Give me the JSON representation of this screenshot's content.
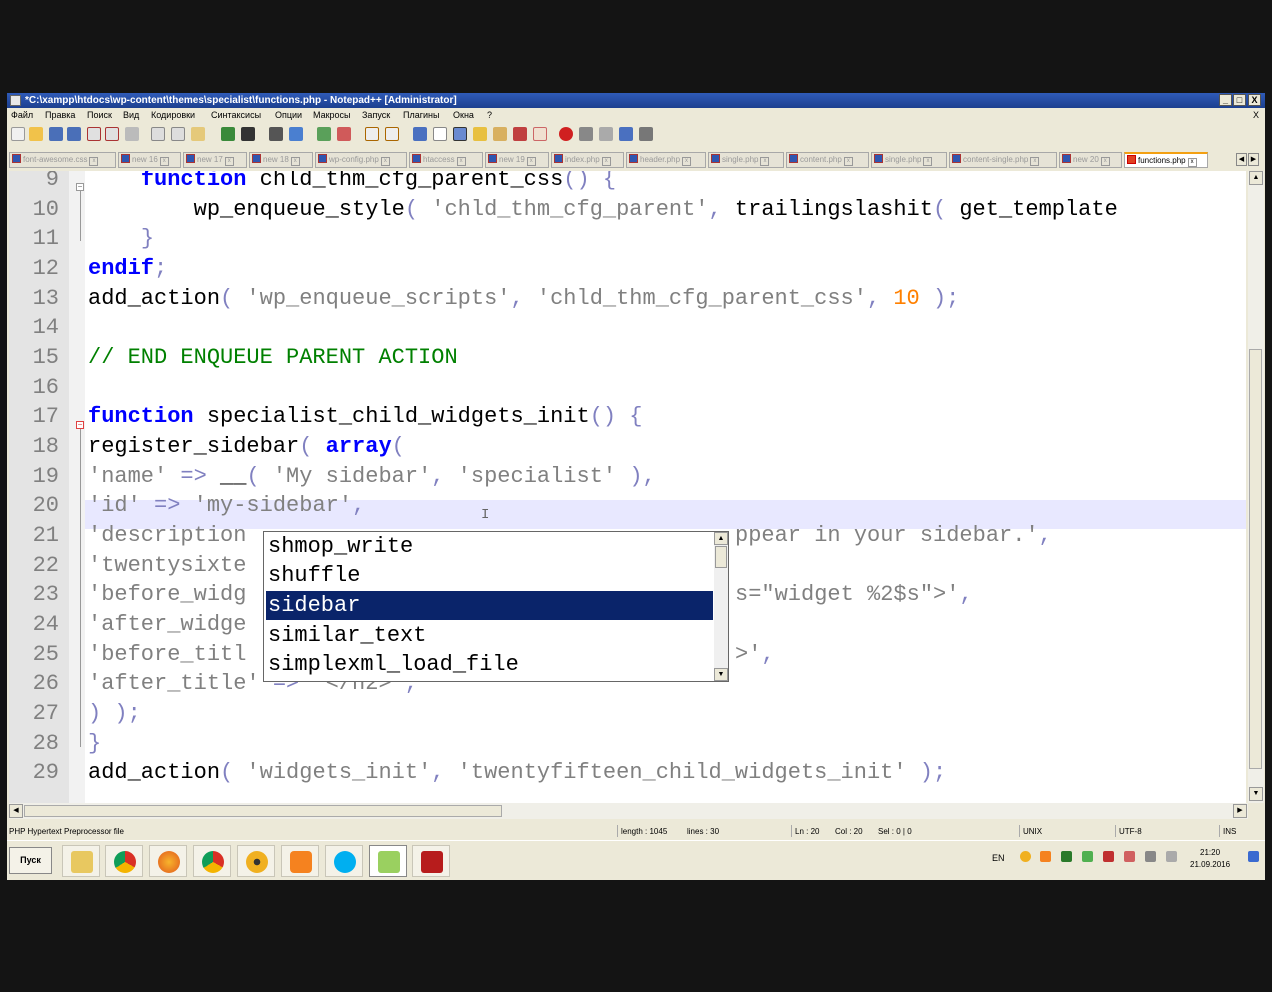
{
  "window": {
    "title": "*C:\\xampp\\htdocs\\wp-content\\themes\\specialist\\functions.php - Notepad++ [Administrator]",
    "min": "_",
    "max": "□",
    "close": "X"
  },
  "menu": [
    "Файл",
    "Правка",
    "Поиск",
    "Вид",
    "Кодировки",
    "Синтаксисы",
    "Опции",
    "Макросы",
    "Запуск",
    "Плагины",
    "Окна",
    "?"
  ],
  "menu_close": "X",
  "tabs": [
    {
      "label": "font-awesome.css"
    },
    {
      "label": "new 16"
    },
    {
      "label": "new 17"
    },
    {
      "label": "new 18"
    },
    {
      "label": "wp-config.php"
    },
    {
      "label": "htaccess"
    },
    {
      "label": "new 19"
    },
    {
      "label": "index.php"
    },
    {
      "label": "header.php"
    },
    {
      "label": "single.php"
    },
    {
      "label": "content.php"
    },
    {
      "label": "single.php"
    },
    {
      "label": "content-single.php"
    },
    {
      "label": "new 20"
    },
    {
      "label": "functions.php"
    }
  ],
  "lines": [
    {
      "n": "9",
      "t": "function"
    },
    {
      "n": "10"
    },
    {
      "n": "11"
    },
    {
      "n": "12"
    },
    {
      "n": "13"
    },
    {
      "n": "14"
    },
    {
      "n": "15"
    },
    {
      "n": "16"
    },
    {
      "n": "17"
    },
    {
      "n": "18"
    },
    {
      "n": "19"
    },
    {
      "n": "20"
    },
    {
      "n": "21"
    },
    {
      "n": "22"
    },
    {
      "n": "23"
    },
    {
      "n": "24"
    },
    {
      "n": "25"
    },
    {
      "n": "26"
    },
    {
      "n": "27"
    },
    {
      "n": "28"
    },
    {
      "n": "29"
    }
  ],
  "code": {
    "l9": {
      "kw": "function",
      "rest": " chld_thm_cfg_parent_css",
      "p": "()",
      "b": " {"
    },
    "l10": {
      "fn": "wp_enqueue_style",
      "p": "(",
      "s": " 'chld_thm_cfg_parent'",
      "c": ",",
      "fn2": " trailingslashit",
      "p2": "(",
      "fn3": " get_template"
    },
    "l11": {
      "b": "}"
    },
    "l12": {
      "kw": "endif",
      "c": ";"
    },
    "l13": {
      "fn": "add_action",
      "p": "(",
      "s1": " 'wp_enqueue_scripts'",
      "c1": ",",
      "s2": " 'chld_thm_cfg_parent_css'",
      "c2": ",",
      "num": " 10",
      "e": " );"
    },
    "l15": {
      "cm": "// END ENQUEUE PARENT ACTION"
    },
    "l17": {
      "kw": "function",
      "rest": " specialist_child_widgets_init",
      "p": "()",
      "b": " {"
    },
    "l18": {
      "fn": "register_sidebar",
      "p": "(",
      "kw": " array",
      "p2": "("
    },
    "l19": {
      "s1": "'name'",
      "op": " =>",
      "fn": " __",
      "p": "(",
      "s2": " 'My sidebar'",
      "c": ",",
      "s3": " 'specialist'",
      "e": " ),"
    },
    "l20": {
      "s1": "'id'",
      "op": " =>",
      "s2": " 'my-sidebar'",
      "c": ","
    },
    "l21": {
      "a": "'description",
      "b": "ppear in your sidebar.'",
      "c": ","
    },
    "l22": {
      "a": "'twentysixte"
    },
    "l23": {
      "a": "'before_widg",
      "b": "s=\"widget %2$s\">'",
      "c": ","
    },
    "l24": {
      "a": "'after_widge"
    },
    "l25": {
      "a": "'before_titl",
      "b": ">'",
      "c": ","
    },
    "l26": {
      "s1": "'after_title'",
      "op": " =>",
      "s2": " '</h2>'",
      "c": ","
    },
    "l27": {
      "e": ") );"
    },
    "l28": {
      "b": "}"
    },
    "l29": {
      "fn": "add_action",
      "p": "(",
      "s1": " 'widgets_init'",
      "c": ",",
      "s2": " 'twentyfifteen_child_widgets_init'",
      "e": " );"
    }
  },
  "autocomplete": {
    "items": [
      "shmop_write",
      "shuffle",
      "sidebar",
      "similar_text",
      "simplexml_load_file"
    ],
    "selected": 2
  },
  "status": {
    "lang": "PHP Hypertext Preprocessor file",
    "length": "length : 1045",
    "lines": "lines : 30",
    "ln": "Ln : 20",
    "col": "Col : 20",
    "sel": "Sel : 0 | 0",
    "eol": "UNIX",
    "enc": "UTF-8",
    "ins": "INS"
  },
  "taskbar": {
    "start": "Пуск",
    "lang": "EN",
    "time": "21:20",
    "date": "21.09.2016"
  }
}
